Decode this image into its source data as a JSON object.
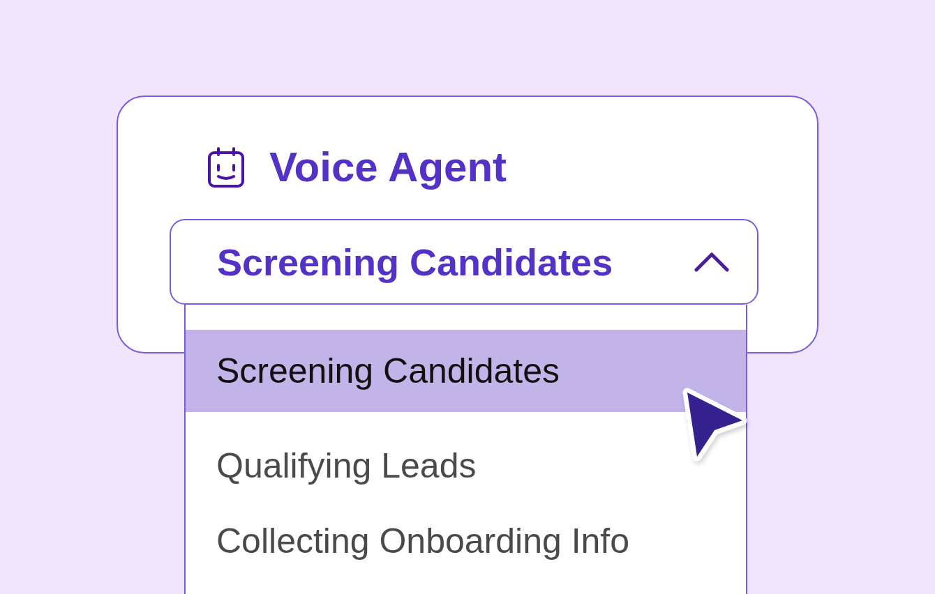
{
  "header": {
    "title": "Voice Agent"
  },
  "dropdown": {
    "value": "Screening Candidates",
    "expanded": true,
    "options": [
      {
        "label": "Screening Candidates",
        "selected": true
      },
      {
        "label": "Qualifying Leads",
        "selected": false
      },
      {
        "label": "Collecting Onboarding Info",
        "selected": false
      }
    ]
  }
}
